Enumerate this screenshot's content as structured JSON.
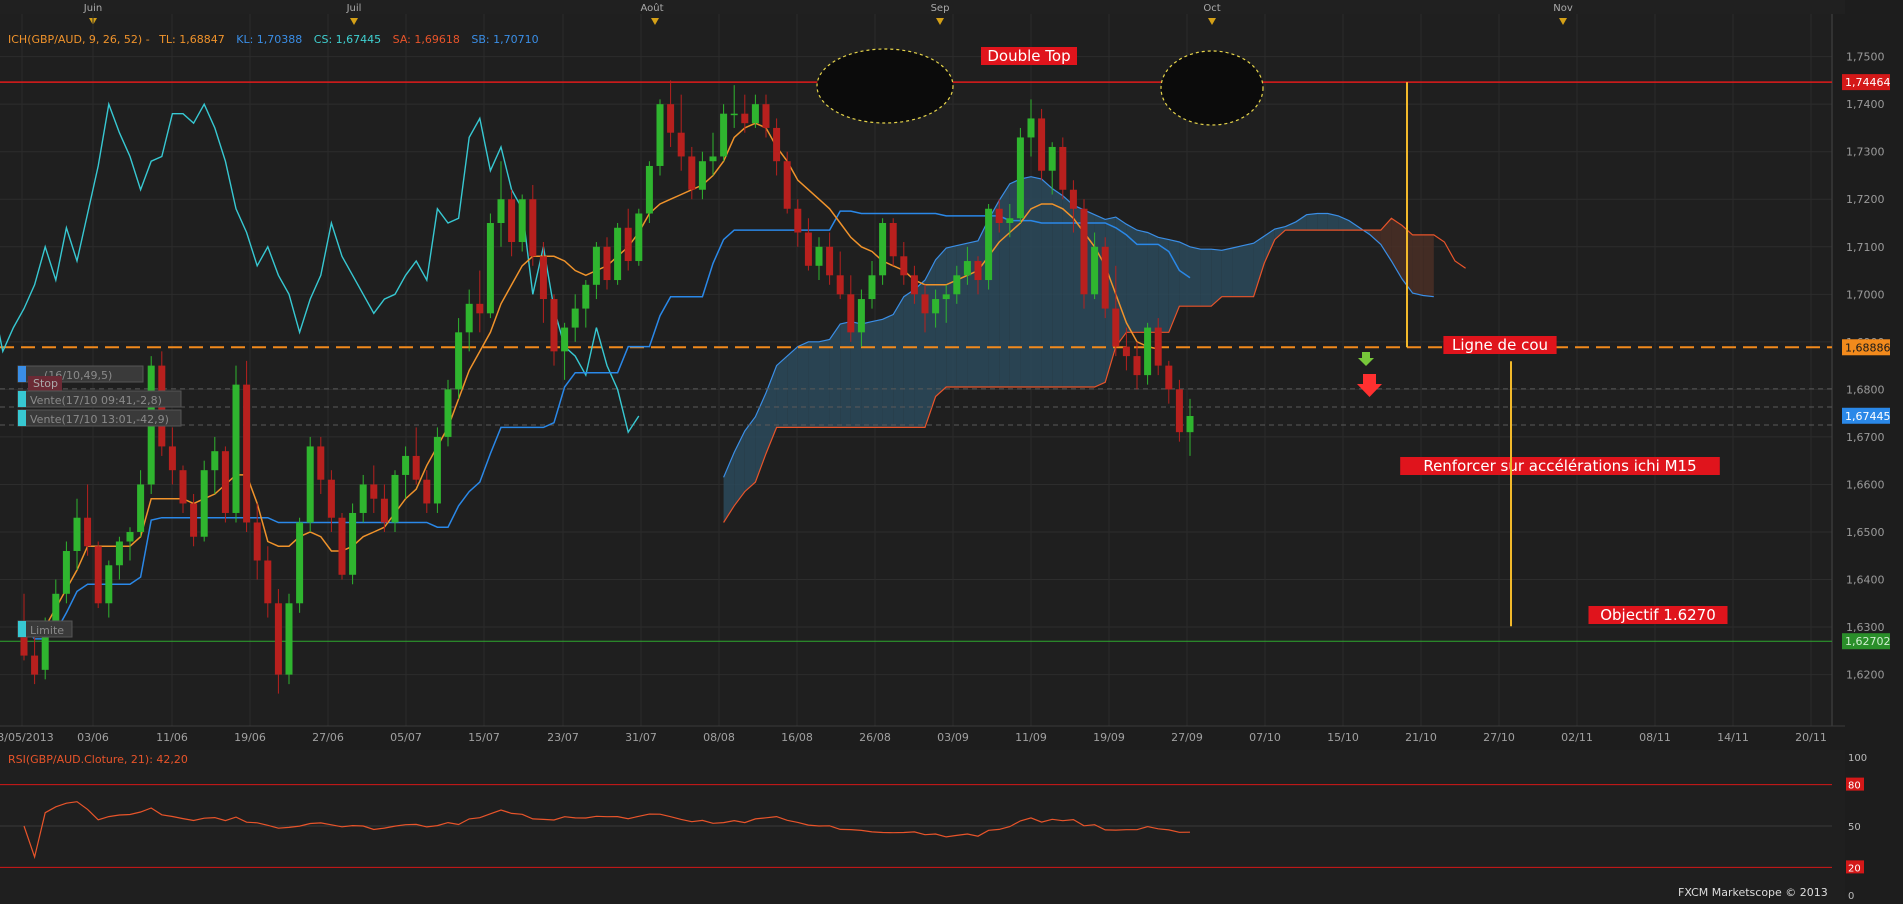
{
  "chart_data": {
    "type": "candlestick",
    "symbol": "GBP/AUD",
    "months": [
      "Juin",
      "Juil",
      "Août",
      "Sep",
      "Oct",
      "Nov"
    ],
    "x_ticks": [
      "23/05/2013",
      "03/06",
      "11/06",
      "19/06",
      "27/06",
      "05/07",
      "15/07",
      "23/07",
      "31/07",
      "08/08",
      "16/08",
      "26/08",
      "03/09",
      "11/09",
      "19/09",
      "27/09",
      "07/10",
      "15/10",
      "21/10",
      "27/10",
      "02/11",
      "08/11",
      "14/11",
      "20/11"
    ],
    "y_ticks": [
      "1,7500",
      "1,7400",
      "1,7300",
      "1,7200",
      "1,7100",
      "1,7000",
      "1,6900",
      "1,6800",
      "1,6700",
      "1,6600",
      "1,6500",
      "1,6400",
      "1,6300",
      "1,6200"
    ],
    "ylim": [
      1.6115,
      1.7535
    ],
    "legend": {
      "ich": "ICH(GBP/AUD, 9, 26, 52) -",
      "tl": "TL: 1,68847",
      "kl": "KL: 1,70388",
      "cs": "CS: 1,67445",
      "sa": "SA: 1,69618",
      "sb": "SB: 1,70710"
    },
    "price_labels": {
      "resistance": "1,74464",
      "neckline": "1,68886",
      "close": "1,67445",
      "target": "1,62702"
    },
    "levels": {
      "resistance": 1.74464,
      "neckline": 1.68886,
      "target": 1.62702,
      "close": 1.67445,
      "order_1": 1.6801,
      "order_2": 1.6763,
      "order_3": 1.6725
    },
    "annotations": {
      "double_top": "Double Top",
      "neckline": "Ligne de cou",
      "reinforce": "Renforcer sur accélérations ichi M15",
      "target": "Objectif 1.6270"
    },
    "orders": [
      {
        "label": "... (16/10,49,5)",
        "tag": "Stop"
      },
      {
        "label": "Vente(17/10 09:41,-2,8)"
      },
      {
        "label": "Vente(17/10 13:01,-42,9)"
      },
      {
        "label": "Limite"
      }
    ],
    "ohlc": [
      [
        1.631,
        1.637,
        1.623,
        1.624
      ],
      [
        1.624,
        1.63,
        1.618,
        1.62
      ],
      [
        1.621,
        1.632,
        1.619,
        1.63
      ],
      [
        1.63,
        1.64,
        1.628,
        1.637
      ],
      [
        1.637,
        1.648,
        1.635,
        1.646
      ],
      [
        1.646,
        1.657,
        1.642,
        1.653
      ],
      [
        1.653,
        1.66,
        1.645,
        1.647
      ],
      [
        1.647,
        1.648,
        1.634,
        1.635
      ],
      [
        1.635,
        1.644,
        1.632,
        1.643
      ],
      [
        1.643,
        1.649,
        1.64,
        1.648
      ],
      [
        1.648,
        1.651,
        1.644,
        1.65
      ],
      [
        1.65,
        1.663,
        1.649,
        1.66
      ],
      [
        1.66,
        1.687,
        1.658,
        1.685
      ],
      [
        1.685,
        1.688,
        1.666,
        1.668
      ],
      [
        1.668,
        1.672,
        1.66,
        1.663
      ],
      [
        1.663,
        1.664,
        1.654,
        1.656
      ],
      [
        1.656,
        1.658,
        1.647,
        1.649
      ],
      [
        1.649,
        1.665,
        1.648,
        1.663
      ],
      [
        1.663,
        1.67,
        1.658,
        1.667
      ],
      [
        1.667,
        1.668,
        1.652,
        1.654
      ],
      [
        1.654,
        1.685,
        1.652,
        1.681
      ],
      [
        1.681,
        1.686,
        1.65,
        1.652
      ],
      [
        1.652,
        1.656,
        1.64,
        1.644
      ],
      [
        1.644,
        1.647,
        1.632,
        1.635
      ],
      [
        1.635,
        1.638,
        1.616,
        1.62
      ],
      [
        1.62,
        1.637,
        1.618,
        1.635
      ],
      [
        1.635,
        1.653,
        1.633,
        1.652
      ],
      [
        1.652,
        1.67,
        1.65,
        1.668
      ],
      [
        1.668,
        1.67,
        1.658,
        1.661
      ],
      [
        1.661,
        1.663,
        1.65,
        1.653
      ],
      [
        1.653,
        1.654,
        1.64,
        1.641
      ],
      [
        1.641,
        1.656,
        1.639,
        1.654
      ],
      [
        1.654,
        1.662,
        1.652,
        1.66
      ],
      [
        1.66,
        1.664,
        1.654,
        1.657
      ],
      [
        1.657,
        1.66,
        1.65,
        1.652
      ],
      [
        1.652,
        1.663,
        1.65,
        1.662
      ],
      [
        1.662,
        1.668,
        1.657,
        1.666
      ],
      [
        1.666,
        1.672,
        1.66,
        1.661
      ],
      [
        1.661,
        1.663,
        1.654,
        1.656
      ],
      [
        1.656,
        1.672,
        1.654,
        1.67
      ],
      [
        1.67,
        1.682,
        1.668,
        1.68
      ],
      [
        1.68,
        1.695,
        1.678,
        1.692
      ],
      [
        1.692,
        1.701,
        1.688,
        1.698
      ],
      [
        1.698,
        1.705,
        1.692,
        1.696
      ],
      [
        1.696,
        1.717,
        1.695,
        1.715
      ],
      [
        1.715,
        1.728,
        1.71,
        1.72
      ],
      [
        1.72,
        1.722,
        1.708,
        1.711
      ],
      [
        1.711,
        1.721,
        1.709,
        1.72
      ],
      [
        1.72,
        1.723,
        1.706,
        1.708
      ],
      [
        1.708,
        1.711,
        1.694,
        1.699
      ],
      [
        1.699,
        1.7,
        1.685,
        1.688
      ],
      [
        1.688,
        1.694,
        1.682,
        1.693
      ],
      [
        1.693,
        1.7,
        1.69,
        1.697
      ],
      [
        1.697,
        1.703,
        1.693,
        1.702
      ],
      [
        1.702,
        1.711,
        1.699,
        1.71
      ],
      [
        1.71,
        1.712,
        1.701,
        1.703
      ],
      [
        1.703,
        1.715,
        1.702,
        1.714
      ],
      [
        1.714,
        1.718,
        1.705,
        1.707
      ],
      [
        1.707,
        1.718,
        1.706,
        1.717
      ],
      [
        1.717,
        1.728,
        1.715,
        1.727
      ],
      [
        1.727,
        1.741,
        1.725,
        1.74
      ],
      [
        1.74,
        1.745,
        1.731,
        1.734
      ],
      [
        1.734,
        1.742,
        1.726,
        1.729
      ],
      [
        1.729,
        1.731,
        1.72,
        1.722
      ],
      [
        1.722,
        1.73,
        1.72,
        1.728
      ],
      [
        1.728,
        1.734,
        1.725,
        1.729
      ],
      [
        1.729,
        1.74,
        1.728,
        1.738
      ],
      [
        1.738,
        1.744,
        1.735,
        1.738
      ],
      [
        1.738,
        1.742,
        1.734,
        1.736
      ],
      [
        1.736,
        1.742,
        1.735,
        1.74
      ],
      [
        1.74,
        1.742,
        1.733,
        1.735
      ],
      [
        1.735,
        1.737,
        1.725,
        1.728
      ],
      [
        1.728,
        1.73,
        1.717,
        1.718
      ],
      [
        1.718,
        1.72,
        1.71,
        1.713
      ],
      [
        1.713,
        1.716,
        1.705,
        1.706
      ],
      [
        1.706,
        1.712,
        1.703,
        1.71
      ],
      [
        1.71,
        1.713,
        1.702,
        1.704
      ],
      [
        1.704,
        1.709,
        1.699,
        1.7
      ],
      [
        1.7,
        1.704,
        1.69,
        1.692
      ],
      [
        1.692,
        1.701,
        1.689,
        1.699
      ],
      [
        1.699,
        1.707,
        1.697,
        1.704
      ],
      [
        1.704,
        1.716,
        1.702,
        1.715
      ],
      [
        1.715,
        1.716,
        1.706,
        1.708
      ],
      [
        1.708,
        1.711,
        1.702,
        1.704
      ],
      [
        1.704,
        1.706,
        1.698,
        1.7
      ],
      [
        1.7,
        1.702,
        1.692,
        1.696
      ],
      [
        1.696,
        1.701,
        1.693,
        1.699
      ],
      [
        1.699,
        1.702,
        1.694,
        1.7
      ],
      [
        1.7,
        1.706,
        1.698,
        1.704
      ],
      [
        1.704,
        1.71,
        1.702,
        1.707
      ],
      [
        1.707,
        1.708,
        1.7,
        1.703
      ],
      [
        1.703,
        1.719,
        1.701,
        1.718
      ],
      [
        1.718,
        1.72,
        1.713,
        1.715
      ],
      [
        1.715,
        1.719,
        1.712,
        1.716
      ],
      [
        1.716,
        1.735,
        1.715,
        1.733
      ],
      [
        1.733,
        1.741,
        1.729,
        1.737
      ],
      [
        1.737,
        1.739,
        1.724,
        1.726
      ],
      [
        1.726,
        1.732,
        1.721,
        1.731
      ],
      [
        1.731,
        1.733,
        1.72,
        1.722
      ],
      [
        1.722,
        1.724,
        1.713,
        1.718
      ],
      [
        1.718,
        1.72,
        1.697,
        1.7
      ],
      [
        1.7,
        1.713,
        1.699,
        1.71
      ],
      [
        1.71,
        1.712,
        1.695,
        1.697
      ],
      [
        1.697,
        1.706,
        1.687,
        1.689
      ],
      [
        1.689,
        1.693,
        1.684,
        1.687
      ],
      [
        1.687,
        1.69,
        1.68,
        1.683
      ],
      [
        1.683,
        1.694,
        1.681,
        1.693
      ],
      [
        1.693,
        1.695,
        1.683,
        1.685
      ],
      [
        1.685,
        1.686,
        1.677,
        1.68
      ],
      [
        1.68,
        1.682,
        1.669,
        1.671
      ],
      [
        1.671,
        1.678,
        1.666,
        1.6744
      ]
    ],
    "tenkan": [
      1.63,
      1.629,
      1.63,
      1.634,
      1.638,
      1.642,
      1.647,
      1.647,
      1.647,
      1.647,
      1.647,
      1.649,
      1.657,
      1.657,
      1.657,
      1.657,
      1.656,
      1.657,
      1.658,
      1.66,
      1.662,
      1.662,
      1.656,
      1.648,
      1.647,
      1.647,
      1.649,
      1.65,
      1.649,
      1.646,
      1.646,
      1.647,
      1.649,
      1.65,
      1.651,
      1.654,
      1.657,
      1.659,
      1.664,
      1.668,
      1.672,
      1.678,
      1.684,
      1.688,
      1.692,
      1.698,
      1.702,
      1.706,
      1.708,
      1.708,
      1.708,
      1.707,
      1.705,
      1.704,
      1.705,
      1.706,
      1.708,
      1.71,
      1.713,
      1.717,
      1.719,
      1.72,
      1.721,
      1.722,
      1.723,
      1.725,
      1.728,
      1.733,
      1.735,
      1.736,
      1.735,
      1.731,
      1.728,
      1.724,
      1.722,
      1.72,
      1.718,
      1.715,
      1.712,
      1.71,
      1.709,
      1.707,
      1.706,
      1.705,
      1.703,
      1.702,
      1.702,
      1.702,
      1.703,
      1.704,
      1.705,
      1.708,
      1.711,
      1.713,
      1.715,
      1.718,
      1.719,
      1.719,
      1.718,
      1.716,
      1.713,
      1.71,
      1.706,
      1.7,
      1.694,
      1.69,
      1.689,
      1.6885
    ]
  }
}
